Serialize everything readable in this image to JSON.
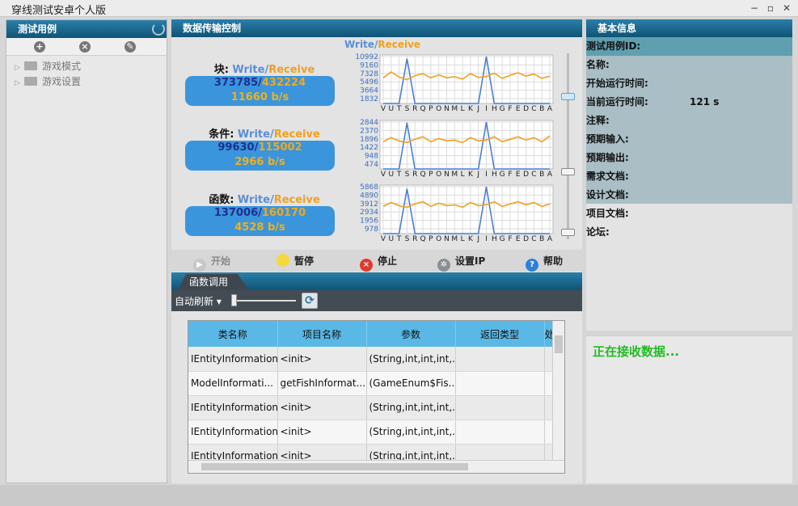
{
  "window": {
    "title": "穿线测试安卓个人版",
    "min": "−",
    "restore": "▫",
    "close": "✕"
  },
  "left": {
    "title": "测试用例",
    "tree": [
      {
        "label": "游戏模式"
      },
      {
        "label": "游戏设置"
      }
    ]
  },
  "transfer": {
    "title": "数据传输控制",
    "legend_write": "Write",
    "legend_sep": "/",
    "legend_receive": "Receive",
    "counters": [
      {
        "label": "块:",
        "write": "373785",
        "receive": "432224",
        "rate": "11660 b/s"
      },
      {
        "label": "条件:",
        "write": "99630",
        "receive": "115002",
        "rate": "2966 b/s"
      },
      {
        "label": "函数:",
        "write": "137006",
        "receive": "160170",
        "rate": "4528 b/s"
      }
    ]
  },
  "chart_data": [
    {
      "type": "line",
      "categories": [
        "V",
        "U",
        "T",
        "S",
        "R",
        "Q",
        "P",
        "O",
        "N",
        "M",
        "L",
        "K",
        "J",
        "I",
        "H",
        "G",
        "F",
        "E",
        "D",
        "C",
        "B",
        "A"
      ],
      "yticks": [
        "10992",
        "9160",
        "7328",
        "5496",
        "3664",
        "1832"
      ],
      "ylim": [
        0,
        10992
      ],
      "series": [
        {
          "color": "#4a7fd6",
          "values": [
            0,
            0,
            0,
            10500,
            0,
            0,
            0,
            0,
            0,
            0,
            0,
            0,
            0,
            10992,
            0,
            0,
            0,
            0,
            0,
            0,
            0,
            0
          ]
        },
        {
          "color": "#f0a020",
          "values": [
            6000,
            7400,
            6200,
            5600,
            6500,
            7000,
            6000,
            6700,
            6000,
            6300,
            5700,
            7000,
            6100,
            6300,
            7100,
            5900,
            6600,
            7200,
            6400,
            6900,
            5900,
            6400
          ]
        }
      ]
    },
    {
      "type": "line",
      "categories": [
        "V",
        "U",
        "T",
        "S",
        "R",
        "Q",
        "P",
        "O",
        "N",
        "M",
        "L",
        "K",
        "J",
        "I",
        "H",
        "G",
        "F",
        "E",
        "D",
        "C",
        "B",
        "A"
      ],
      "yticks": [
        "2844",
        "2370",
        "1896",
        "1422",
        "948",
        "474"
      ],
      "ylim": [
        0,
        2844
      ],
      "series": [
        {
          "color": "#4a7fd6",
          "values": [
            0,
            0,
            0,
            2800,
            0,
            0,
            0,
            0,
            0,
            0,
            0,
            0,
            0,
            2844,
            0,
            0,
            0,
            0,
            0,
            0,
            0,
            0
          ]
        },
        {
          "color": "#f0a020",
          "values": [
            1650,
            1900,
            1700,
            1600,
            1800,
            1950,
            1650,
            1850,
            1700,
            1750,
            1600,
            1900,
            1700,
            1750,
            1950,
            1650,
            1800,
            1950,
            1750,
            1900,
            1650,
            2000
          ]
        }
      ]
    },
    {
      "type": "line",
      "categories": [
        "V",
        "U",
        "T",
        "S",
        "R",
        "Q",
        "P",
        "O",
        "N",
        "M",
        "L",
        "K",
        "J",
        "I",
        "H",
        "G",
        "F",
        "E",
        "D",
        "C",
        "B",
        "A"
      ],
      "yticks": [
        "5868",
        "4890",
        "3912",
        "2934",
        "1956",
        "978"
      ],
      "ylim": [
        0,
        5868
      ],
      "series": [
        {
          "color": "#4a7fd6",
          "values": [
            0,
            0,
            0,
            5600,
            0,
            0,
            0,
            0,
            0,
            0,
            0,
            0,
            0,
            5868,
            0,
            0,
            0,
            0,
            0,
            0,
            0,
            0
          ]
        },
        {
          "color": "#f0a020",
          "values": [
            3400,
            3900,
            3500,
            3300,
            3700,
            4000,
            3400,
            3800,
            3500,
            3600,
            3300,
            3900,
            3500,
            3600,
            4000,
            3400,
            3700,
            4000,
            3600,
            3900,
            3400,
            3700
          ]
        }
      ]
    }
  ],
  "controls": {
    "start": "开始",
    "pause": "暂停",
    "stop": "停止",
    "setip": "设置IP",
    "help": "帮助"
  },
  "calls": {
    "tab": "函数调用",
    "auto": "自动刷新",
    "columns": [
      "类名称",
      "项目名称",
      "参数",
      "返回类型",
      "处"
    ],
    "rows": [
      [
        "IEntityInformation",
        "<init>",
        "(String,int,int,int,...",
        ""
      ],
      [
        "ModelInformati...",
        "getFishInformat...",
        "(GameEnum$Fis...",
        ""
      ],
      [
        "IEntityInformation",
        "<init>",
        "(String,int,int,int,...",
        ""
      ],
      [
        "IEntityInformation",
        "<init>",
        "(String,int,int,int,...",
        ""
      ],
      [
        "IEntityInformation",
        "<init>",
        "(String,int,int,int,...",
        ""
      ]
    ]
  },
  "info": {
    "title": "基本信息",
    "rows": [
      {
        "label": "测试用例ID:",
        "value": ""
      },
      {
        "label": "名称:",
        "value": ""
      },
      {
        "label": "开始运行时间:",
        "value": ""
      },
      {
        "label": "当前运行时间:",
        "value": "121 s"
      },
      {
        "label": "注释:",
        "value": ""
      },
      {
        "label": "预期输入:",
        "value": ""
      },
      {
        "label": "预期输出:",
        "value": ""
      },
      {
        "label": "需求文档:",
        "value": ""
      },
      {
        "label": "设计文档:",
        "value": ""
      },
      {
        "label": "项目文档:",
        "value": ""
      },
      {
        "label": "论坛:",
        "value": ""
      }
    ],
    "status": "正在接收数据..."
  },
  "colors": {
    "header": "#0f5476",
    "accent": "#3a95dc",
    "write": "#4a7fd6",
    "receive": "#f0a020",
    "status": "#22bb22"
  }
}
